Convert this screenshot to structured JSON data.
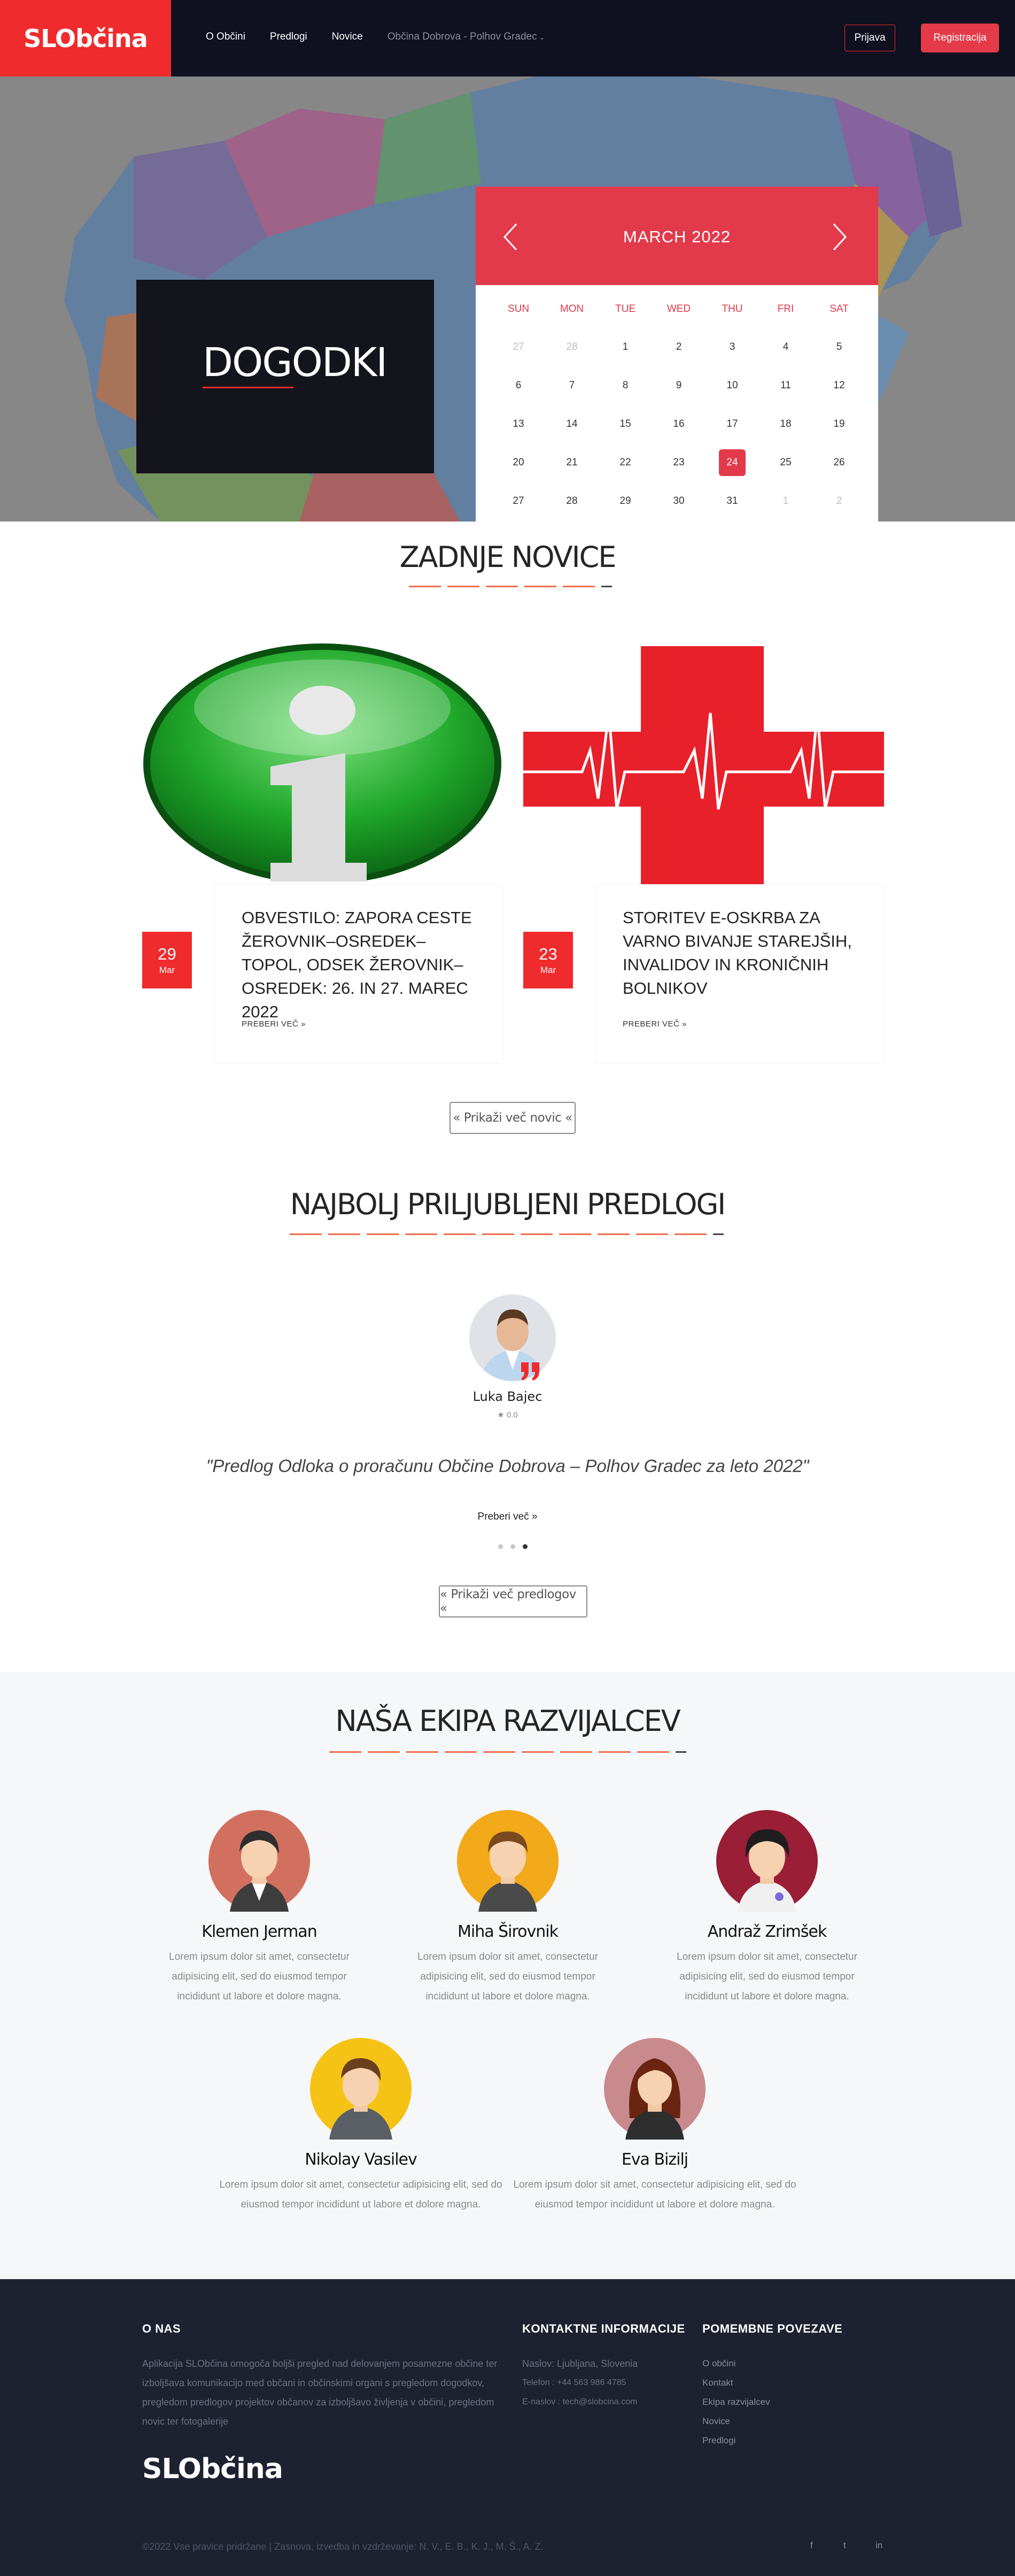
{
  "header": {
    "logo": "SLObčina",
    "nav": [
      "O Občini",
      "Predlogi",
      "Novice"
    ],
    "municipality": "Občina Dobrova - Polhov Gradec",
    "login": "Prijava",
    "register": "Registracija"
  },
  "hero": {
    "title": "DOGODKI",
    "calendar": {
      "month": "MARCH  2022",
      "weekdays": [
        "SUN",
        "MON",
        "TUE",
        "WED",
        "THU",
        "FRI",
        "SAT"
      ],
      "days": [
        "27",
        "28",
        "1",
        "2",
        "3",
        "4",
        "5",
        "6",
        "7",
        "8",
        "9",
        "10",
        "11",
        "12",
        "13",
        "14",
        "15",
        "16",
        "17",
        "18",
        "19",
        "20",
        "21",
        "22",
        "23",
        "24",
        "25",
        "26",
        "27",
        "28",
        "29",
        "30",
        "31",
        "1",
        "2"
      ],
      "selected": "24"
    }
  },
  "news": {
    "title": "ZADNJE NOVICE",
    "items": [
      {
        "day": "29",
        "month": "Mar",
        "title": "OBVESTILO: ZAPORA CESTE ŽEROVNIK–OSREDEK–TOPOL, ODSEK ŽEROVNIK–OSREDEK: 26. IN 27. MAREC 2022",
        "more": "PREBERI VEČ »"
      },
      {
        "day": "23",
        "month": "Mar",
        "title": "STORITEV E-OSKRBA ZA VARNO BIVANJE STAREJŠIH, INVALIDOV IN KRONIČNIH BOLNIKOV",
        "more": "PREBERI VEČ »"
      }
    ],
    "more_button": "« Prikaži več novic «"
  },
  "proposals": {
    "title": "NAJBOLJ PRILJUBLJENI PREDLOGI",
    "author": "Luka Bajec",
    "rating": "★ 0.0",
    "quote": "\"Predlog Odloka o proračunu Občine Dobrova – Polhov Gradec za leto 2022\"",
    "read_more": "Preberi več »",
    "more_button": "« Prikaži več predlogov «"
  },
  "team": {
    "title": "NAŠA EKIPA RAZVIJALCEV",
    "members": [
      {
        "name": "Klemen Jerman",
        "desc": "Lorem ipsum dolor sit amet, consectetur adipisicing elit, sed do eiusmod tempor incididunt ut labore et dolore magna."
      },
      {
        "name": "Miha Širovnik",
        "desc": "Lorem ipsum dolor sit amet, consectetur adipisicing elit, sed do eiusmod tempor incididunt ut labore et dolore magna."
      },
      {
        "name": "Andraž Zrimšek",
        "desc": "Lorem ipsum dolor sit amet, consectetur adipisicing elit, sed do eiusmod tempor incididunt ut labore et dolore magna."
      },
      {
        "name": "Nikolay Vasilev",
        "desc": "Lorem ipsum dolor sit amet, consectetur adipisicing elit, sed do eiusmod tempor incididunt ut labore et dolore magna."
      },
      {
        "name": "Eva Bizilj",
        "desc": "Lorem ipsum dolor sit amet, consectetur adipisicing elit, sed do eiusmod tempor incididunt ut labore et dolore magna."
      }
    ]
  },
  "footer": {
    "about_title": "O NAS",
    "about_text": "Aplikacija SLObčina omogoča boljši pregled nad delovanjem posamezne občine ter izboljšava komunikacijo med občani in občinskimi organi s pregledom dogodkov, pregledom predlogov projektov občanov za izboljšavo življenja v občini, pregledom novic ter fotogalerije",
    "contact_title": "KONTAKTNE INFORMACIJE",
    "contact": [
      "Naslov: Ljubljana, Slovenia",
      "Telefon : +44 563 986 4785",
      "E-naslov : tech@slobcina.com"
    ],
    "links_title": "POMEMBNE POVEZAVE",
    "links": [
      "O občini",
      "Kontakt",
      "Ekipa razvijalcev",
      "Novice",
      "Predlogi"
    ],
    "logo": "SLObčina",
    "copyright": "©2022 Vse pravice pridržane | Zasnova, izvedba in vzdrževanje: N. V., E. B., K. J., M. Š., A. Z.",
    "social": [
      "f",
      "t",
      "in"
    ]
  },
  "colors": {
    "brand_red": "#ef2b2d",
    "calendar_red": "#e23a4a",
    "dark_navy": "#0f1120",
    "footer_bg": "#1d2130"
  }
}
